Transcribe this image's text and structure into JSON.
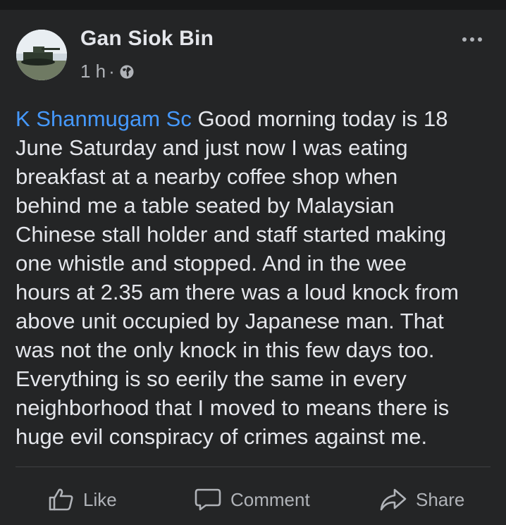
{
  "post": {
    "author": "Gan Siok Bin",
    "time": "1 h",
    "separator": "·",
    "privacy_icon": "globe-icon",
    "more_icon": "more-options-icon",
    "mention": "K Shanmugam Sc",
    "text": " Good morning today is 18\nJune Saturday and just now I was eating\nbreakfast at a nearby coffee shop when\nbehind me a table seated by Malaysian\nChinese stall holder and staff started making\none whistle and stopped. And in the wee\nhours at 2.35 am there was a loud knock from\nabove unit occupied by Japanese man.  That\nwas not the only knock in this few days too.\nEverything is so eerily the same in every\nneighborhood that I moved to means there is\nhuge evil conspiracy of crimes against me."
  },
  "actions": {
    "like": "Like",
    "comment": "Comment",
    "share": "Share"
  },
  "colors": {
    "background": "#242526",
    "text": "#e4e6eb",
    "secondary": "#b0b3b8",
    "mention": "#4599ff"
  }
}
